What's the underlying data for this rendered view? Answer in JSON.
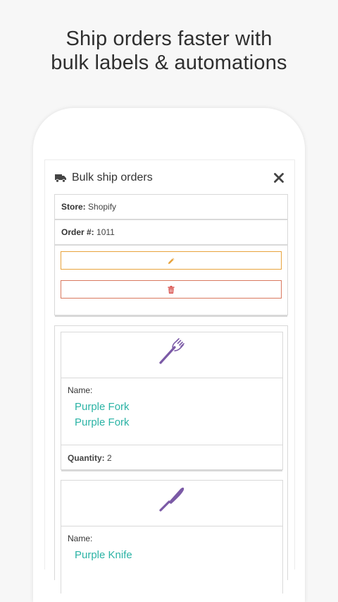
{
  "headline": {
    "line1": "Ship orders faster with",
    "line2": "bulk labels & automations"
  },
  "modal": {
    "title": "Bulk ship orders",
    "icons": {
      "title": "truck-icon",
      "close": "close-icon"
    }
  },
  "order": {
    "store_label": "Store:",
    "store_value": "Shopify",
    "order_label": "Order #:",
    "order_value": "1011",
    "edit_icon": "pencil-icon",
    "delete_icon": "trash-icon"
  },
  "items": [
    {
      "icon": "fork-icon",
      "name_label": "Name:",
      "names": [
        "Purple Fork",
        "Purple Fork"
      ],
      "quantity_label": "Quantity:",
      "quantity_value": "2"
    },
    {
      "icon": "knife-icon",
      "name_label": "Name:",
      "names": [
        "Purple Knife"
      ]
    }
  ],
  "colors": {
    "accent_teal": "#2bb3a5",
    "edit_orange": "#e8a33d",
    "delete_red": "#d9795f",
    "utensil_purple": "#7b5aa6"
  }
}
